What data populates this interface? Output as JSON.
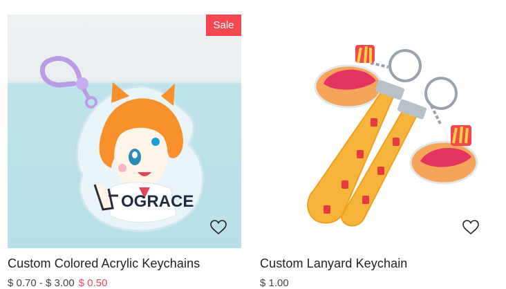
{
  "products": [
    {
      "title": "Custom Colored Acrylic Keychains",
      "badge": "Sale",
      "wishlist_icon": "heart-outline-icon",
      "price_range": "$ 0.70 - $ 3.00",
      "sale_price_range": "$ 0.50"
    },
    {
      "title": "Custom Lanyard Keychain",
      "wishlist_icon": "heart-outline-icon",
      "price_range": "$ 1.00"
    }
  ],
  "colors": {
    "sale_badge": "#f5474f",
    "title_text": "#222222"
  },
  "image_text": {
    "keychain_print": "OGRACE"
  }
}
